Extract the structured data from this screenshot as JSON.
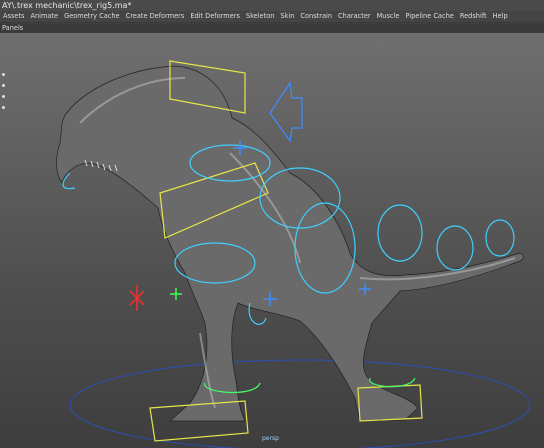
{
  "window": {
    "title": "AY\\.trex mechanic\\trex_rig5.ma*"
  },
  "menubar": {
    "items": [
      "Assets",
      "Animate",
      "Geometry Cache",
      "Create Deformers",
      "Edit Deformers",
      "Skeleton",
      "Skin",
      "Constrain",
      "Character",
      "Muscle",
      "Pipeline Cache",
      "Redshift",
      "Help"
    ]
  },
  "panels_menu": {
    "label": "Panels"
  },
  "viewport": {
    "ground_label": "persp"
  }
}
